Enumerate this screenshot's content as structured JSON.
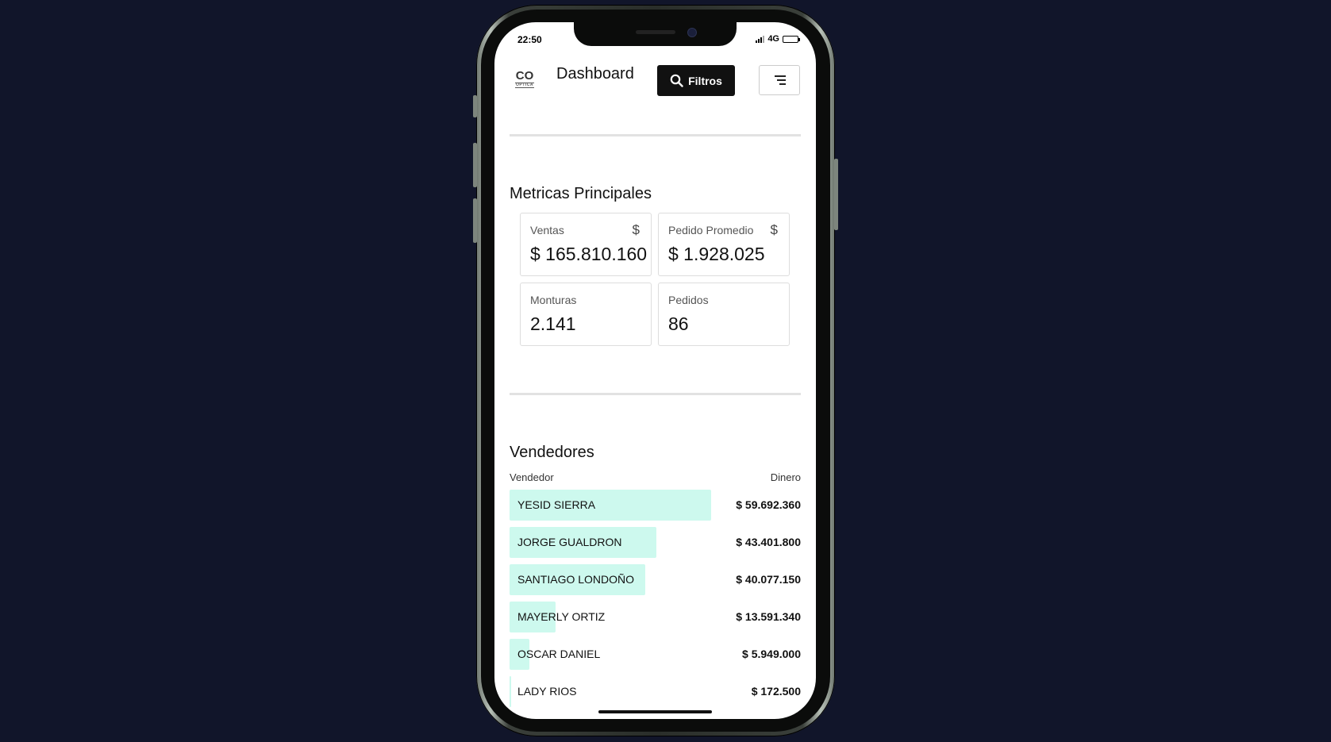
{
  "status": {
    "time": "22:50",
    "network": "4G",
    "battery_level": 1.0
  },
  "header": {
    "logo_text": "CO",
    "logo_sub": "OPTICA",
    "title": "Dashboard",
    "filter_label": "Filtros"
  },
  "metrics": {
    "title": "Metricas Principales",
    "cards": [
      {
        "label": "Ventas",
        "value": "$ 165.810.160",
        "icon": "$"
      },
      {
        "label": "Pedido Promedio",
        "value": "$ 1.928.025",
        "icon": "$"
      },
      {
        "label": "Monturas",
        "value": "2.141",
        "icon": ""
      },
      {
        "label": "Pedidos",
        "value": "86",
        "icon": ""
      }
    ]
  },
  "sellers": {
    "title": "Vendedores",
    "col_name": "Vendedor",
    "col_amount": "Dinero",
    "rows": [
      {
        "name": "YESID SIERRA",
        "amount": "$ 59.692.360",
        "value": 59692360
      },
      {
        "name": "JORGE GUALDRON",
        "amount": "$ 43.401.800",
        "value": 43401800
      },
      {
        "name": "SANTIAGO LONDOÑO",
        "amount": "$ 40.077.150",
        "value": 40077150
      },
      {
        "name": "MAYERLY ORTIZ",
        "amount": "$ 13.591.340",
        "value": 13591340
      },
      {
        "name": "OSCAR DANIEL",
        "amount": "$ 5.949.000",
        "value": 5949000
      },
      {
        "name": "LADY RIOS",
        "amount": "$ 172.500",
        "value": 172500
      }
    ]
  }
}
